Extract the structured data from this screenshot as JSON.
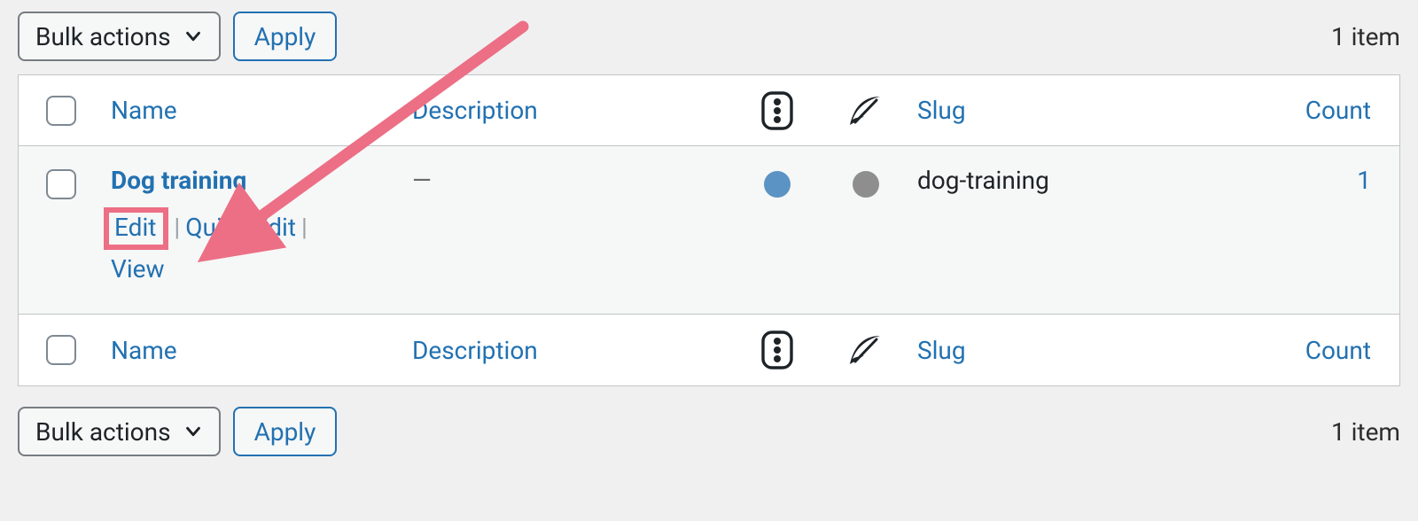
{
  "toolbar": {
    "bulk_actions_label": "Bulk actions",
    "apply_label": "Apply",
    "item_count_text": "1 item"
  },
  "columns": {
    "name": "Name",
    "description": "Description",
    "slug": "Slug",
    "count": "Count"
  },
  "rows": [
    {
      "title": "Dog training",
      "description": "—",
      "slug": "dog-training",
      "count": "1",
      "actions": {
        "edit": "Edit",
        "quick_edit": "Quick Edit",
        "view": "View"
      }
    }
  ],
  "annotation": {
    "arrow_color": "#ec6f85"
  }
}
